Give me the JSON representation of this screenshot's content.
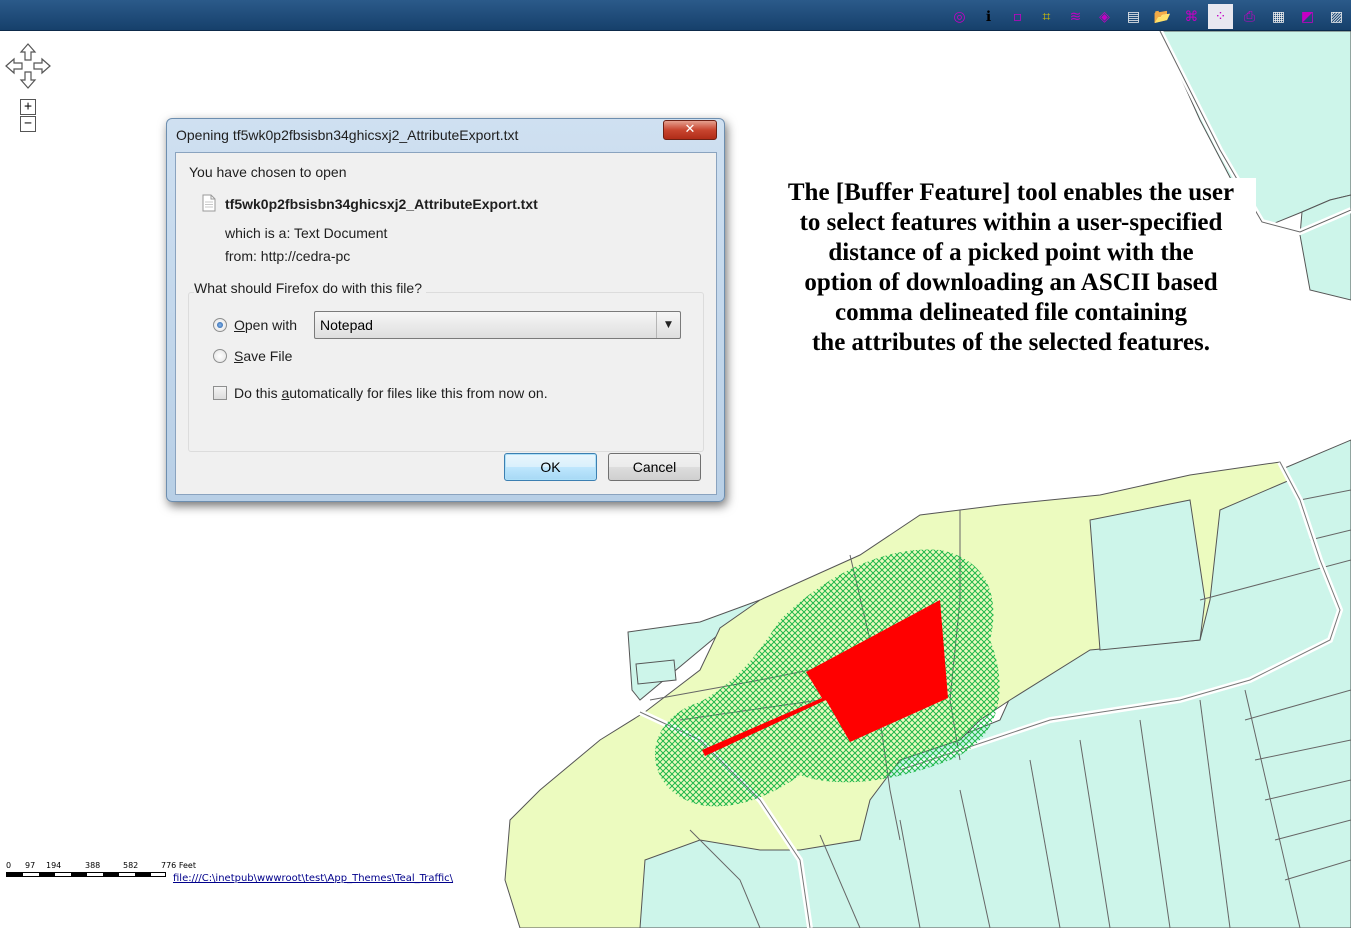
{
  "toolbar": {
    "tools": [
      {
        "icon": "zoom-extent-icon",
        "glyph": "◎"
      },
      {
        "icon": "info-icon",
        "glyph": "ℹ"
      },
      {
        "icon": "select-box-icon",
        "glyph": "▫"
      },
      {
        "icon": "crop-icon",
        "glyph": "⌗"
      },
      {
        "icon": "layers-icon",
        "glyph": "≋"
      },
      {
        "icon": "buffer-feature-icon",
        "glyph": "◈"
      },
      {
        "icon": "legend-icon",
        "glyph": "▤"
      },
      {
        "icon": "open-folder-icon",
        "glyph": "📂"
      },
      {
        "icon": "select-polygon-icon",
        "glyph": "⌘"
      },
      {
        "icon": "select-points-icon",
        "glyph": "⁘"
      },
      {
        "icon": "print-icon",
        "glyph": "⎙"
      },
      {
        "icon": "table-icon",
        "glyph": "▦"
      },
      {
        "icon": "chart-icon",
        "glyph": "◩"
      },
      {
        "icon": "report-icon",
        "glyph": "▨"
      }
    ],
    "active_index": 9
  },
  "map": {
    "zoom_in_label": "+",
    "zoom_out_label": "−",
    "colors": {
      "parcel_fill": "#cdf5ea",
      "selected_fill": "#ecfbbf",
      "buffer_hatch": "#1fb84b",
      "feature_fill": "#ff0000",
      "road": "#ffffff"
    }
  },
  "info_box": {
    "lines": [
      "The [Buffer Feature] tool enables the user",
      "to select features within a user-specified",
      "distance of a picked point with the",
      "option of downloading an ASCII based",
      "comma delineated file containing",
      "the attributes of the selected features."
    ]
  },
  "scalebar": {
    "ticks": [
      "0",
      "97",
      "194",
      "388",
      "582",
      "776 Feet"
    ]
  },
  "status": {
    "file_link": "file:///C:\\inetpub\\wwwroot\\test\\App_Themes\\Teal_Traffic\\"
  },
  "dialog": {
    "title": "Opening tf5wk0p2fbsisbn34ghicsxj2_AttributeExport.txt",
    "chosen_label": "You have chosen to open",
    "file_name": "tf5wk0p2fbsisbn34ghicsxj2_AttributeExport.txt",
    "which_is_label": "which is a:",
    "which_is_value": "Text Document",
    "from_label": "from:",
    "from_value": "http://cedra-pc",
    "question": "What should Firefox do with this file?",
    "open_with_label_pre": "",
    "open_with_accel": "O",
    "open_with_label_post": "pen with",
    "open_with_app": "Notepad",
    "save_file_accel": "S",
    "save_file_label_post": "ave File",
    "auto_pre": "Do this ",
    "auto_accel": "a",
    "auto_post": "utomatically for files like this from now on.",
    "ok_label": "OK",
    "cancel_label": "Cancel",
    "close_glyph": "✕",
    "selected_option": "open_with",
    "auto_checked": false
  }
}
